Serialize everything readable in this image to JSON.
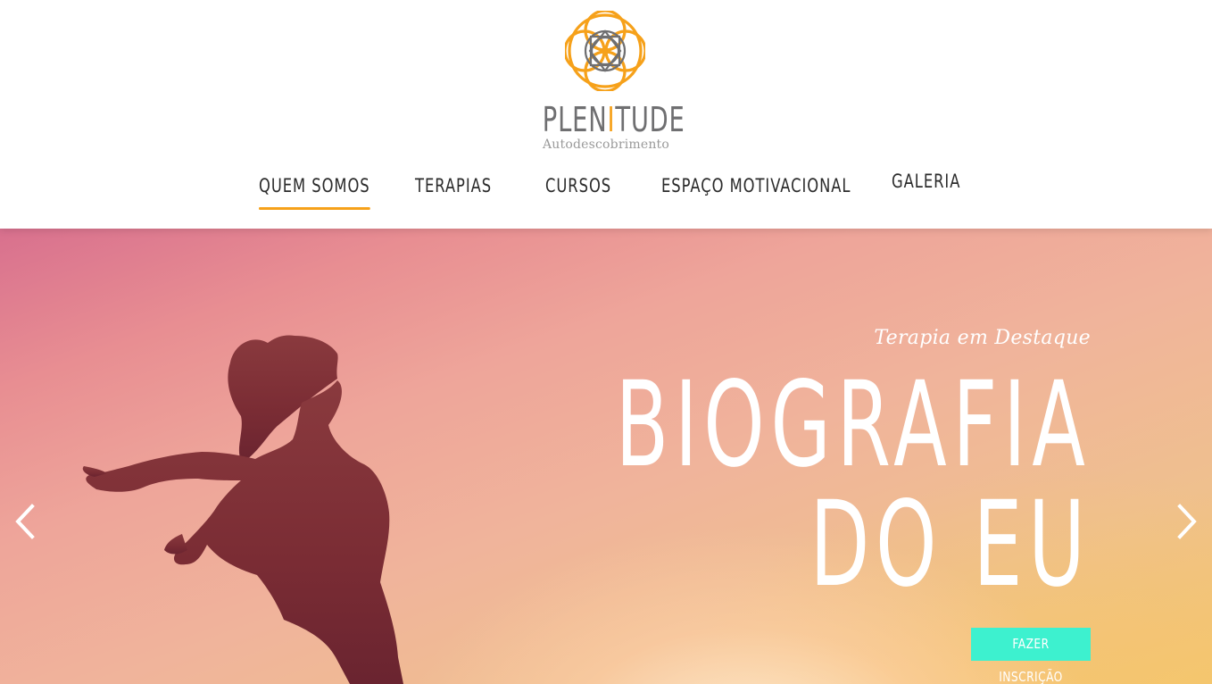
{
  "brand": {
    "name_left": "PLEN",
    "name_accent": "I",
    "name_right": "TUDE",
    "tagline": "Autodescobrimento",
    "logo_icon": "flower-mandala-icon"
  },
  "nav": {
    "items": [
      {
        "label": "QUEM SOMOS",
        "active": true
      },
      {
        "label": "TERAPIAS",
        "active": false
      },
      {
        "label": "CURSOS",
        "active": false
      },
      {
        "label": "ESPAÇO MOTIVACIONAL",
        "active": false
      },
      {
        "label": "GALERIA",
        "active": false
      }
    ]
  },
  "hero": {
    "subtitle": "Terapia em Destaque",
    "title_line1": "BIOGRAFIA",
    "title_line2": "DO EU",
    "cta_label": "FAZER INSCRIÇÃO",
    "prev_icon": "chevron-left-icon",
    "next_icon": "chevron-right-icon"
  },
  "colors": {
    "accent": "#f6a11a",
    "brand_gray": "#6f6f71",
    "cta": "#3df1cf",
    "nav_text": "#2b2b2b"
  }
}
